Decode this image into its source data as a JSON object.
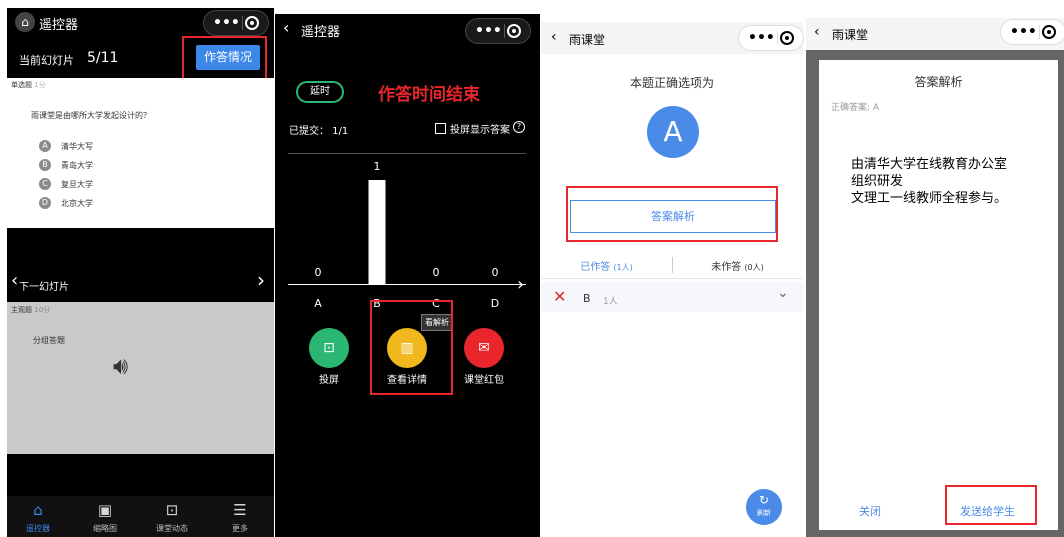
{
  "panel1": {
    "title": "遥控器",
    "slide_label": "当前幻灯片",
    "slide_counter": "5/11",
    "status_button": "作答情况",
    "q_type": "单选题",
    "q_score": "1分",
    "question": "雨课堂是由哪所大学发起设计的？",
    "options": [
      {
        "letter": "A",
        "text": "清华大写"
      },
      {
        "letter": "B",
        "text": "青岛大学"
      },
      {
        "letter": "C",
        "text": "复旦大学"
      },
      {
        "letter": "D",
        "text": "北京大学"
      }
    ],
    "next_slide": "下一幻灯片",
    "q2_type": "主观题",
    "q2_score": "10分",
    "q2_text": "分组答题",
    "tabs": [
      "遥控器",
      "缩略图",
      "课堂动态",
      "更多"
    ]
  },
  "panel2": {
    "title": "遥控器",
    "extend_button": "延时",
    "time_over": "作答时间结束",
    "submitted": "已提交：  1/1",
    "show_answer": "投屏显示答案",
    "help_mark": "?",
    "tooltip": "看解析",
    "buttons": [
      "投屏",
      "查看详情",
      "课堂红包"
    ]
  },
  "panel3": {
    "title": "雨课堂",
    "correct_title": "本题正确选项为",
    "answer_letter": "A",
    "analysis_button": "答案解析",
    "tab_answered": "已作答",
    "tab_answered_count": "(1人)",
    "tab_unanswered": "未作答",
    "tab_unanswered_count": "(0人)",
    "wrong_option": "B",
    "wrong_count": "1人",
    "refresh": "刷新"
  },
  "panel4": {
    "title": "雨课堂",
    "dialog_title": "答案解析",
    "correct_answer": "正确答案: A",
    "analysis_lines": [
      "由清华大学在线教育办公室",
      "组织研发",
      "文理工一线教师全程参与。"
    ],
    "close": "关闭",
    "send": "发送给学生"
  },
  "chart_data": {
    "type": "bar",
    "categories": [
      "A",
      "B",
      "C",
      "D"
    ],
    "values": [
      0,
      1,
      0,
      0
    ],
    "ylim": [
      0,
      1
    ]
  }
}
